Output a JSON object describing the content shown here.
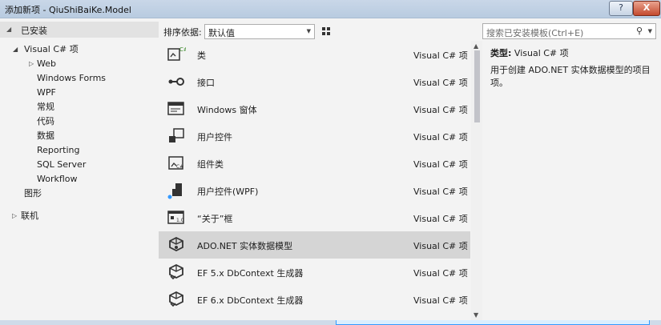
{
  "window": {
    "title": "添加新项 - QiuShiBaiKe.Model",
    "help_label": "?",
    "close_label": "X"
  },
  "left": {
    "installed_label": "已安装",
    "tree": [
      {
        "label": "Visual C# 项",
        "level": 1,
        "expander": "◢"
      },
      {
        "label": "Web",
        "level": 2,
        "expander": "▷"
      },
      {
        "label": "Windows Forms",
        "level": 3,
        "expander": ""
      },
      {
        "label": "WPF",
        "level": 3,
        "expander": ""
      },
      {
        "label": "常规",
        "level": 3,
        "expander": ""
      },
      {
        "label": "代码",
        "level": 3,
        "expander": ""
      },
      {
        "label": "数据",
        "level": 3,
        "expander": ""
      },
      {
        "label": "Reporting",
        "level": 3,
        "expander": ""
      },
      {
        "label": "SQL Server",
        "level": 3,
        "expander": ""
      },
      {
        "label": "Workflow",
        "level": 3,
        "expander": ""
      },
      {
        "label": "图形",
        "level": 2,
        "expander": ""
      },
      {
        "label": "联机",
        "level": 1,
        "expander": "▷"
      }
    ]
  },
  "toolbar": {
    "sort_label": "排序依据:",
    "sort_value": "默认值"
  },
  "templates": [
    {
      "name": "类",
      "type": "Visual C# 项",
      "icon": "class-icon",
      "selected": false
    },
    {
      "name": "接口",
      "type": "Visual C# 项",
      "icon": "interface-icon",
      "selected": false
    },
    {
      "name": "Windows 窗体",
      "type": "Visual C# 项",
      "icon": "windows-form-icon",
      "selected": false
    },
    {
      "name": "用户控件",
      "type": "Visual C# 项",
      "icon": "user-control-icon",
      "selected": false
    },
    {
      "name": "组件类",
      "type": "Visual C# 项",
      "icon": "component-class-icon",
      "selected": false
    },
    {
      "name": "用户控件(WPF)",
      "type": "Visual C# 项",
      "icon": "wpf-user-control-icon",
      "selected": false
    },
    {
      "name": "“关于”框",
      "type": "Visual C# 项",
      "icon": "about-box-icon",
      "selected": false
    },
    {
      "name": "ADO.NET 实体数据模型",
      "type": "Visual C# 项",
      "icon": "entity-model-icon",
      "selected": true
    },
    {
      "name": "EF 5.x DbContext 生成器",
      "type": "Visual C# 项",
      "icon": "dbcontext-generator-icon",
      "selected": false
    },
    {
      "name": "EF 6.x DbContext 生成器",
      "type": "Visual C# 项",
      "icon": "dbcontext-generator-icon",
      "selected": false
    }
  ],
  "search": {
    "placeholder": "搜索已安装模板(Ctrl+E)"
  },
  "details": {
    "type_label": "类型:",
    "type_value": "Visual C# 项",
    "description": "用于创建 ADO.NET 实体数据模型的项目项。"
  },
  "colors": {
    "selection": "#d5d5d5",
    "accent": "#3399ff"
  }
}
